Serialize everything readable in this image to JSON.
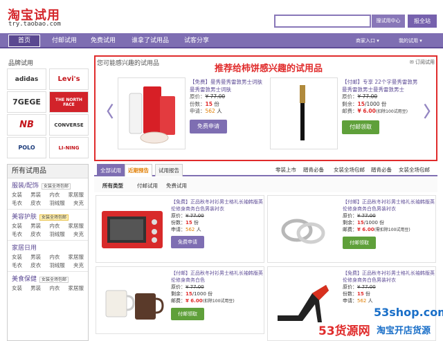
{
  "header": {
    "logo": "淘宝试用",
    "logo_sub": "try.taobao.com",
    "search_button": "搜试用中心",
    "report_button": "报全站"
  },
  "nav": {
    "items": [
      "首页",
      "付邮试用",
      "免费试用",
      "谁拿了试用品",
      "试客分享"
    ],
    "right": [
      "商家入口",
      "我的试用"
    ]
  },
  "brands": {
    "title": "品牌试用",
    "list": [
      "adidas",
      "Levi's",
      "7GEGE",
      "THE NORTH FACE",
      "NB",
      "CONVERSE",
      "POLO",
      "LI-NING"
    ]
  },
  "categories": {
    "title": "所有试用品",
    "groups": [
      {
        "name": "服装/配饰",
        "tag": "女装全场包邮",
        "rows": [
          [
            "女装",
            "男装",
            "内衣",
            "家居服"
          ],
          [
            "毛衣",
            "皮衣",
            "羽绒服",
            "夹克"
          ]
        ]
      },
      {
        "name": "美容护肤",
        "tag": "女装全场包邮",
        "rows": [
          [
            "女装",
            "男装",
            "内衣",
            "家居服"
          ],
          [
            "毛衣",
            "皮衣",
            "羽绒服",
            "夹克"
          ]
        ]
      },
      {
        "name": "家居日用",
        "tag": "",
        "rows": [
          [
            "女装",
            "男装",
            "内衣",
            "家居服"
          ],
          [
            "毛衣",
            "皮衣",
            "羽绒服",
            "夹克"
          ]
        ]
      },
      {
        "name": "美食保健",
        "tag": "女装全场包邮",
        "rows": [
          [
            "女装",
            "男装",
            "内衣",
            "家居服"
          ]
        ]
      }
    ]
  },
  "recommend": {
    "heading": "您可能感兴趣的试用品",
    "highlight": "推荐给柿饼感兴趣的试用品",
    "subscribe": "订阅试用",
    "prev": "〈",
    "next": "〉",
    "cards": [
      {
        "title": "【免费】曼秀曼秀雷敦男士词肤曼秀雷敦男士词肤",
        "orig_label": "原价：",
        "orig": "¥ 77.00",
        "count_label": "份数：",
        "count": "15",
        "count_unit": " 份",
        "apply_label": "申请：",
        "apply": "562",
        "apply_unit": " 人",
        "button": "免费申请"
      },
      {
        "title": "【付邮】专享 22个字曼秀雷敦男曼秀雷敦男士曼秀雷敦男士",
        "orig_label": "原价：",
        "orig": "¥ 77.00",
        "count_label": "剩余：",
        "count": "15",
        "count_unit": "/1000 份",
        "apply_label": "邮费：",
        "apply": "¥ 6.00",
        "apply_unit": "(扣除100试用豆)",
        "button": "付邮领取"
      }
    ]
  },
  "tabs": {
    "items": [
      "全部试用",
      "近期预告",
      "试用报告"
    ],
    "links": [
      "零装上市",
      "踏青必备",
      "女装全场包邮",
      "踏青必备",
      "女装全场包邮"
    ]
  },
  "filter": [
    "所有类型",
    "付邮试用",
    "免费试用"
  ],
  "items": [
    {
      "title": "【免费】正品秋冬衬衫男士格礼长袖韩版英伦修身商务白色男装衬衣",
      "l1": "原价：",
      "v1": "¥ 77.00",
      "l2": "份数：",
      "v2": "15",
      "u2": " 份",
      "l3": "申请：",
      "v3": "562",
      "u3": " 人",
      "button": "免费申请"
    },
    {
      "title": "【付邮】正品秋冬衬衫男士格礼长袖韩版英伦修身商务白色男装衬衣",
      "l1": "原价：",
      "v1": "¥ 77.00",
      "l2": "剩余：",
      "v2": "15",
      "u2": "/1000 份",
      "l3": "邮费：",
      "v3": "¥ 6.00",
      "u3": "(需扣除100试用豆)",
      "button": "付邮领取"
    },
    {
      "title": "【付邮】正品秋冬衬衫男士格礼长袖韩版英伦修身商务白色",
      "l1": "原价：",
      "v1": "¥ 77.00",
      "l2": "剩余：",
      "v2": "15",
      "u2": "/1000 份",
      "l3": "邮费：",
      "v3": "¥ 6.00",
      "u3": "(扣除100试用豆)",
      "button": "付邮领取"
    },
    {
      "title": "【免费】正品秋冬衬衫男士格礼长袖韩版英伦修身商务白色男装衬衣",
      "l1": "原价：",
      "v1": "¥ 77.00",
      "l2": "份数：",
      "v2": "15",
      "u2": " 份",
      "l3": "申请：",
      "v3": "562",
      "u3": " 人",
      "button": ""
    }
  ],
  "watermark": {
    "w1": "53shop.com",
    "w2": "53货源网",
    "w3": "淘宝开店货源"
  },
  "colors": {
    "accent": "#7e6eb2",
    "red": "#e02b2b",
    "green": "#5fa03a"
  }
}
